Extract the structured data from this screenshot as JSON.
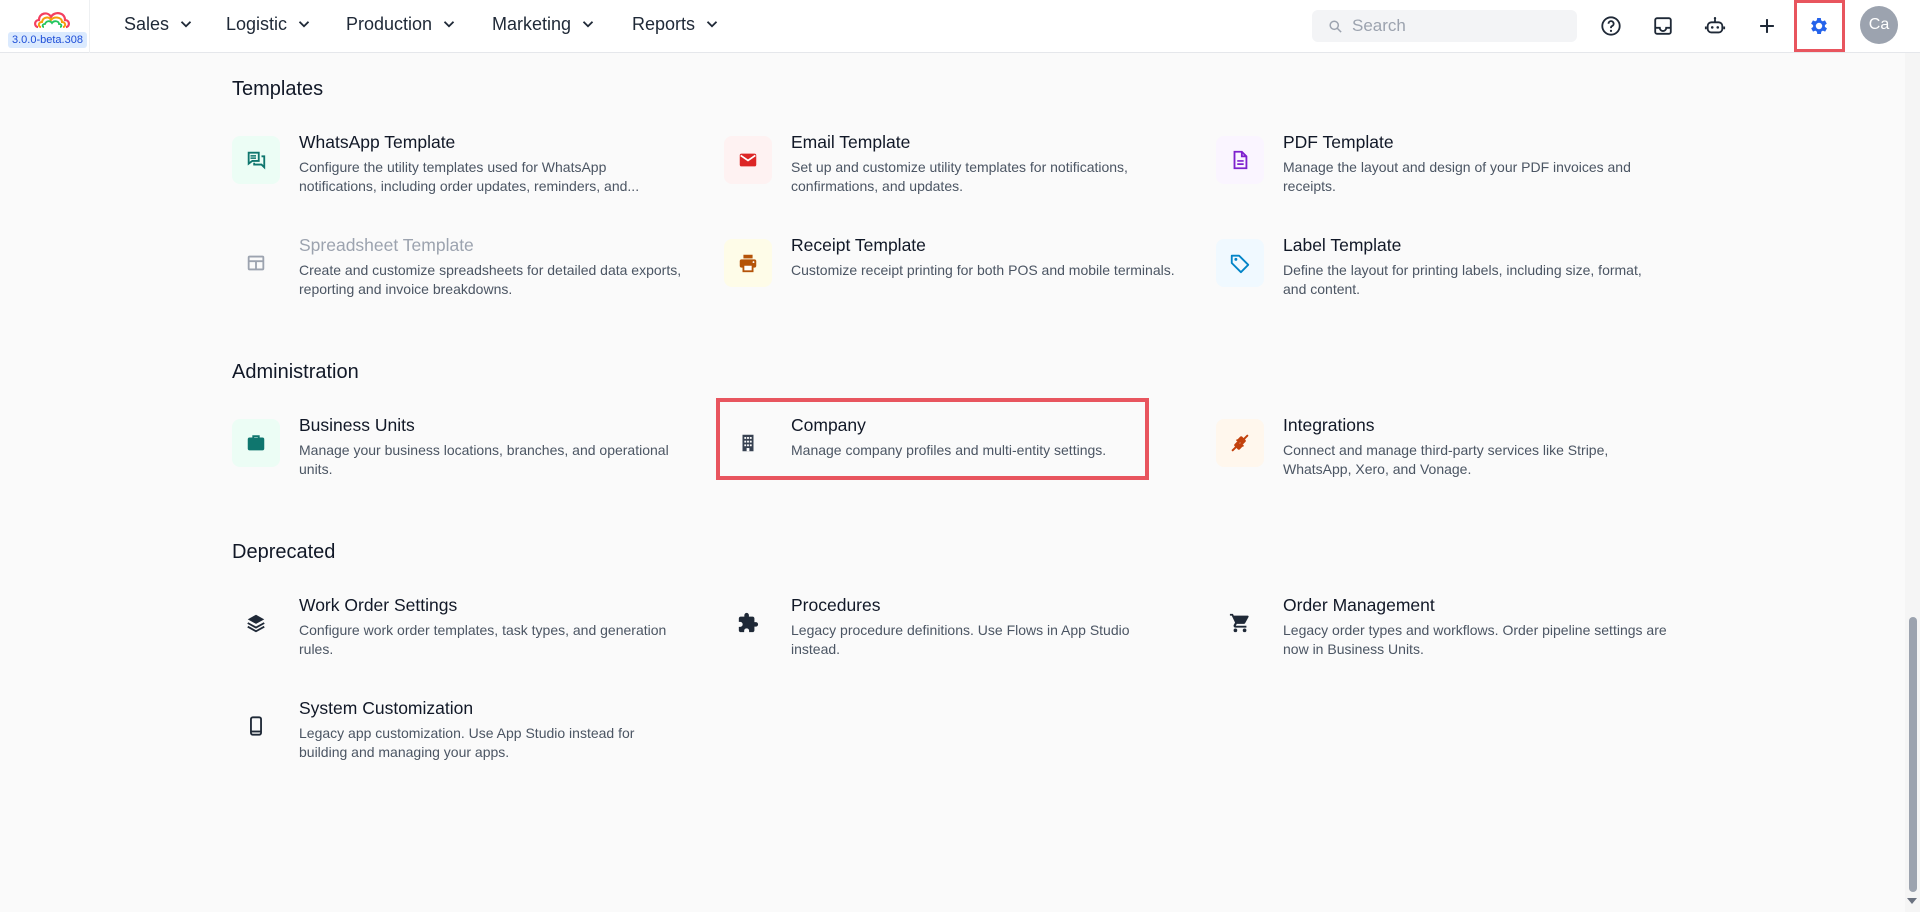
{
  "app": {
    "version": "3.0.0-beta.308"
  },
  "nav": {
    "items": [
      {
        "label": "Sales"
      },
      {
        "label": "Logistic"
      },
      {
        "label": "Production"
      },
      {
        "label": "Marketing"
      },
      {
        "label": "Reports"
      }
    ],
    "search_placeholder": "Search",
    "avatar_initials": "Ca",
    "toolbar_icons": [
      "help-icon",
      "inbox-icon",
      "bot-icon",
      "plus-icon",
      "settings-icon"
    ],
    "active_color": "#2563eb"
  },
  "sections": {
    "templates": {
      "title": "Templates",
      "cards": [
        {
          "title": "WhatsApp Template",
          "desc": "Configure the utility templates used for WhatsApp notifications, including order updates, reminders, and...",
          "icon": "chat-icon",
          "color": "#0f766e"
        },
        {
          "title": "Email Template",
          "desc": "Set up and customize utility templates for notifications, confirmations, and updates.",
          "icon": "mail-icon",
          "color": "#dc2626"
        },
        {
          "title": "PDF Template",
          "desc": "Manage the layout and design of your PDF invoices and receipts.",
          "icon": "document-icon",
          "color": "#7e22ce"
        },
        {
          "title": "Spreadsheet Template",
          "desc": "Create and customize spreadsheets for detailed data exports, reporting and invoice breakdowns.",
          "icon": "table-icon",
          "color": "#9ca3af",
          "disabled": true
        },
        {
          "title": "Receipt Template",
          "desc": "Customize receipt printing for both POS and mobile terminals.",
          "icon": "printer-icon",
          "color": "#b45309"
        },
        {
          "title": "Label Template",
          "desc": "Define the layout for printing labels, including size, format, and content.",
          "icon": "tag-icon",
          "color": "#0284c7"
        }
      ]
    },
    "administration": {
      "title": "Administration",
      "cards": [
        {
          "title": "Business Units",
          "desc": "Manage your business locations, branches, and operational units.",
          "icon": "briefcase-icon",
          "color": "#0f766e"
        },
        {
          "title": "Company",
          "desc": "Manage company profiles and multi-entity settings.",
          "icon": "building-icon",
          "color": "#374151"
        },
        {
          "title": "Integrations",
          "desc": "Connect and manage third-party services like Stripe, WhatsApp, Xero, and Vonage.",
          "icon": "plug-icon",
          "color": "#c2410c"
        }
      ]
    },
    "deprecated": {
      "title": "Deprecated",
      "cards": [
        {
          "title": "Work Order Settings",
          "desc": "Configure work order templates, task types, and generation rules.",
          "icon": "layers-icon",
          "color": "#1f2937"
        },
        {
          "title": "Procedures",
          "desc": "Legacy procedure definitions. Use Flows in App Studio instead.",
          "icon": "puzzle-icon",
          "color": "#1f2937"
        },
        {
          "title": "Order Management",
          "desc": "Legacy order types and workflows. Order pipeline settings are now in Business Units.",
          "icon": "cart-icon",
          "color": "#1f2937"
        },
        {
          "title": "System Customization",
          "desc": "Legacy app customization. Use App Studio instead for building and managing your apps.",
          "icon": "phone-icon",
          "color": "#1f2937"
        }
      ]
    }
  }
}
